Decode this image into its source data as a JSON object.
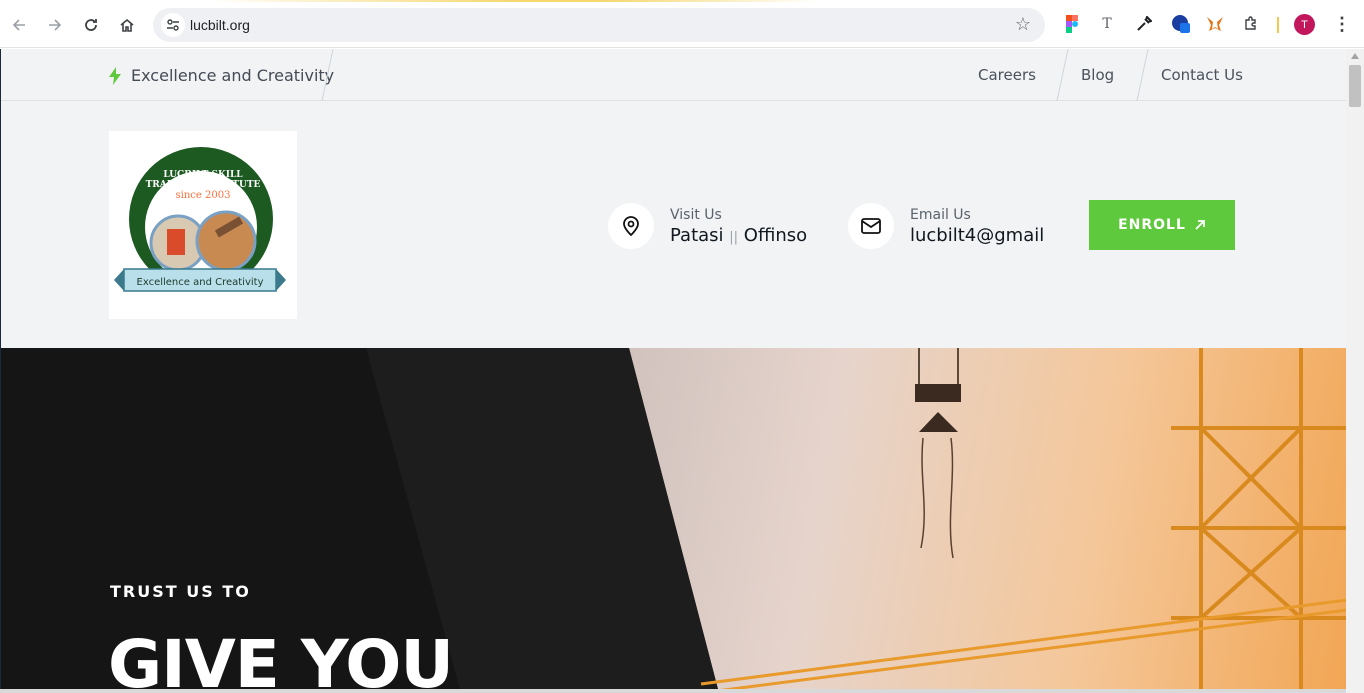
{
  "browser": {
    "url": "lucbilt.org",
    "profile_initial": "T",
    "icons": [
      "back-icon",
      "forward-icon",
      "reload-icon",
      "home-icon",
      "site-settings-icon",
      "bookmark-star-icon",
      "extensions-icon",
      "menu-icon"
    ]
  },
  "topbar": {
    "tagline": "Excellence and Creativity",
    "nav": [
      "Careers",
      "Blog",
      "Contact Us"
    ]
  },
  "logo": {
    "line1": "LUCBILT SKILL",
    "line2": "TRAINING INSTITUTE",
    "line3": "since 2003",
    "ribbon": "Excellence and Creativity"
  },
  "header": {
    "visit": {
      "label": "Visit Us",
      "value_a": "Patasi",
      "sep": "||",
      "value_b": "Offinso"
    },
    "email": {
      "label": "Email Us",
      "value": "lucbilt4@gmail"
    },
    "enroll_label": "ENROLL"
  },
  "hero": {
    "subtitle": "TRUST US TO",
    "title": "GIVE YOU"
  },
  "colors": {
    "accent": "#5fc93d",
    "background": "#f1f3f5",
    "hero_dark": "#151515"
  }
}
